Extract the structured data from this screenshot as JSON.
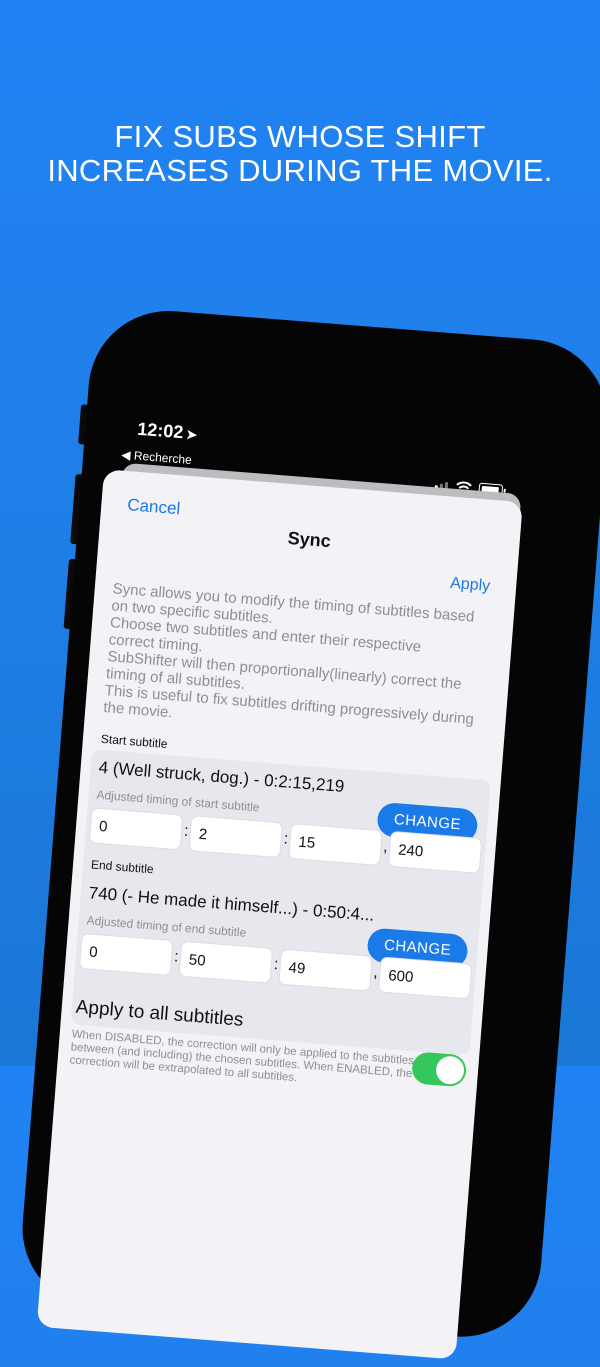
{
  "headline": {
    "line1": "FIX SUBS WHOSE SHIFT",
    "line2": "INCREASES DURING THE MOVIE."
  },
  "status_bar": {
    "time": "12:02",
    "back_label": "Recherche",
    "icons": [
      "location-arrow-icon",
      "signal-icon",
      "wifi-icon",
      "battery-icon"
    ]
  },
  "nav": {
    "cancel": "Cancel",
    "title": "Sync",
    "apply": "Apply"
  },
  "description": {
    "line1": "Sync allows you to modify the timing of subtitles based",
    "line2": "on two specific subtitles.",
    "line3": "Choose two subtitles and enter their respective",
    "line4": "correct timing.",
    "line5": "SubShifter will then proportionally(linearly) correct the",
    "line6": "timing of all subtitles.",
    "line7": "This is useful to fix subtitles drifting progressively during",
    "line8": "the movie."
  },
  "start": {
    "section_label": "Start subtitle",
    "subtitle": "4 (Well struck, dog.) - 0:2:15,219",
    "adjusted_label": "Adjusted timing of start subtitle",
    "change": "CHANGE",
    "hours": "0",
    "minutes": "2",
    "seconds": "15",
    "millis": "240"
  },
  "end": {
    "section_label": "End subtitle",
    "subtitle": "740 (- He made it himself...) - 0:50:4...",
    "adjusted_label": "Adjusted timing of end subtitle",
    "change": "CHANGE",
    "hours": "0",
    "minutes": "50",
    "seconds": "49",
    "millis": "600"
  },
  "separators": {
    "colon": ":",
    "comma": ","
  },
  "apply_all": {
    "label": "Apply to all subtitles",
    "note1": "When DISABLED, the correction will only be applied to the subtitles",
    "note2": "between (and including) the chosen subtitles. When ENABLED, the",
    "note3": "correction will be extrapolated to all subtitles.",
    "enabled": true
  },
  "colors": {
    "background": "#2182f4",
    "accent": "#1a7ae8",
    "toggle_on": "#34c759"
  }
}
